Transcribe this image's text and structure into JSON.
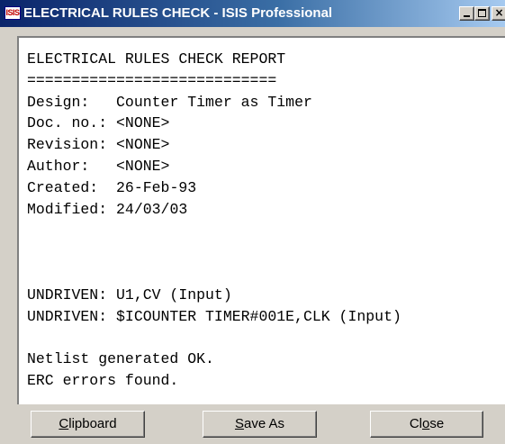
{
  "window": {
    "app_icon_text": "ISIS",
    "title": "ELECTRICAL RULES CHECK - ISIS Professional",
    "controls": {
      "minimize": "minimize",
      "maximize": "maximize",
      "close_glyph": "×"
    }
  },
  "report": {
    "heading": "ELECTRICAL RULES CHECK REPORT",
    "rule": "============================",
    "fields": [
      {
        "label": "Design:   ",
        "value": "Counter Timer as Timer"
      },
      {
        "label": "Doc. no.: ",
        "value": "<NONE>"
      },
      {
        "label": "Revision: ",
        "value": "<NONE>"
      },
      {
        "label": "Author:   ",
        "value": "<NONE>"
      },
      {
        "label": "Created:  ",
        "value": "26-Feb-93"
      },
      {
        "label": "Modified: ",
        "value": "24/03/03"
      }
    ],
    "errors": [
      "UNDRIVEN: U1,CV (Input)",
      "UNDRIVEN: $ICOUNTER TIMER#001E,CLK (Input)"
    ],
    "summary": [
      "Netlist generated OK.",
      "ERC errors found."
    ]
  },
  "buttons": {
    "clipboard": {
      "accel": "C",
      "rest": "lipboard"
    },
    "save_as": {
      "accel": "S",
      "rest": "ave As"
    },
    "close": {
      "pre": "Cl",
      "accel": "o",
      "rest": "se"
    }
  }
}
